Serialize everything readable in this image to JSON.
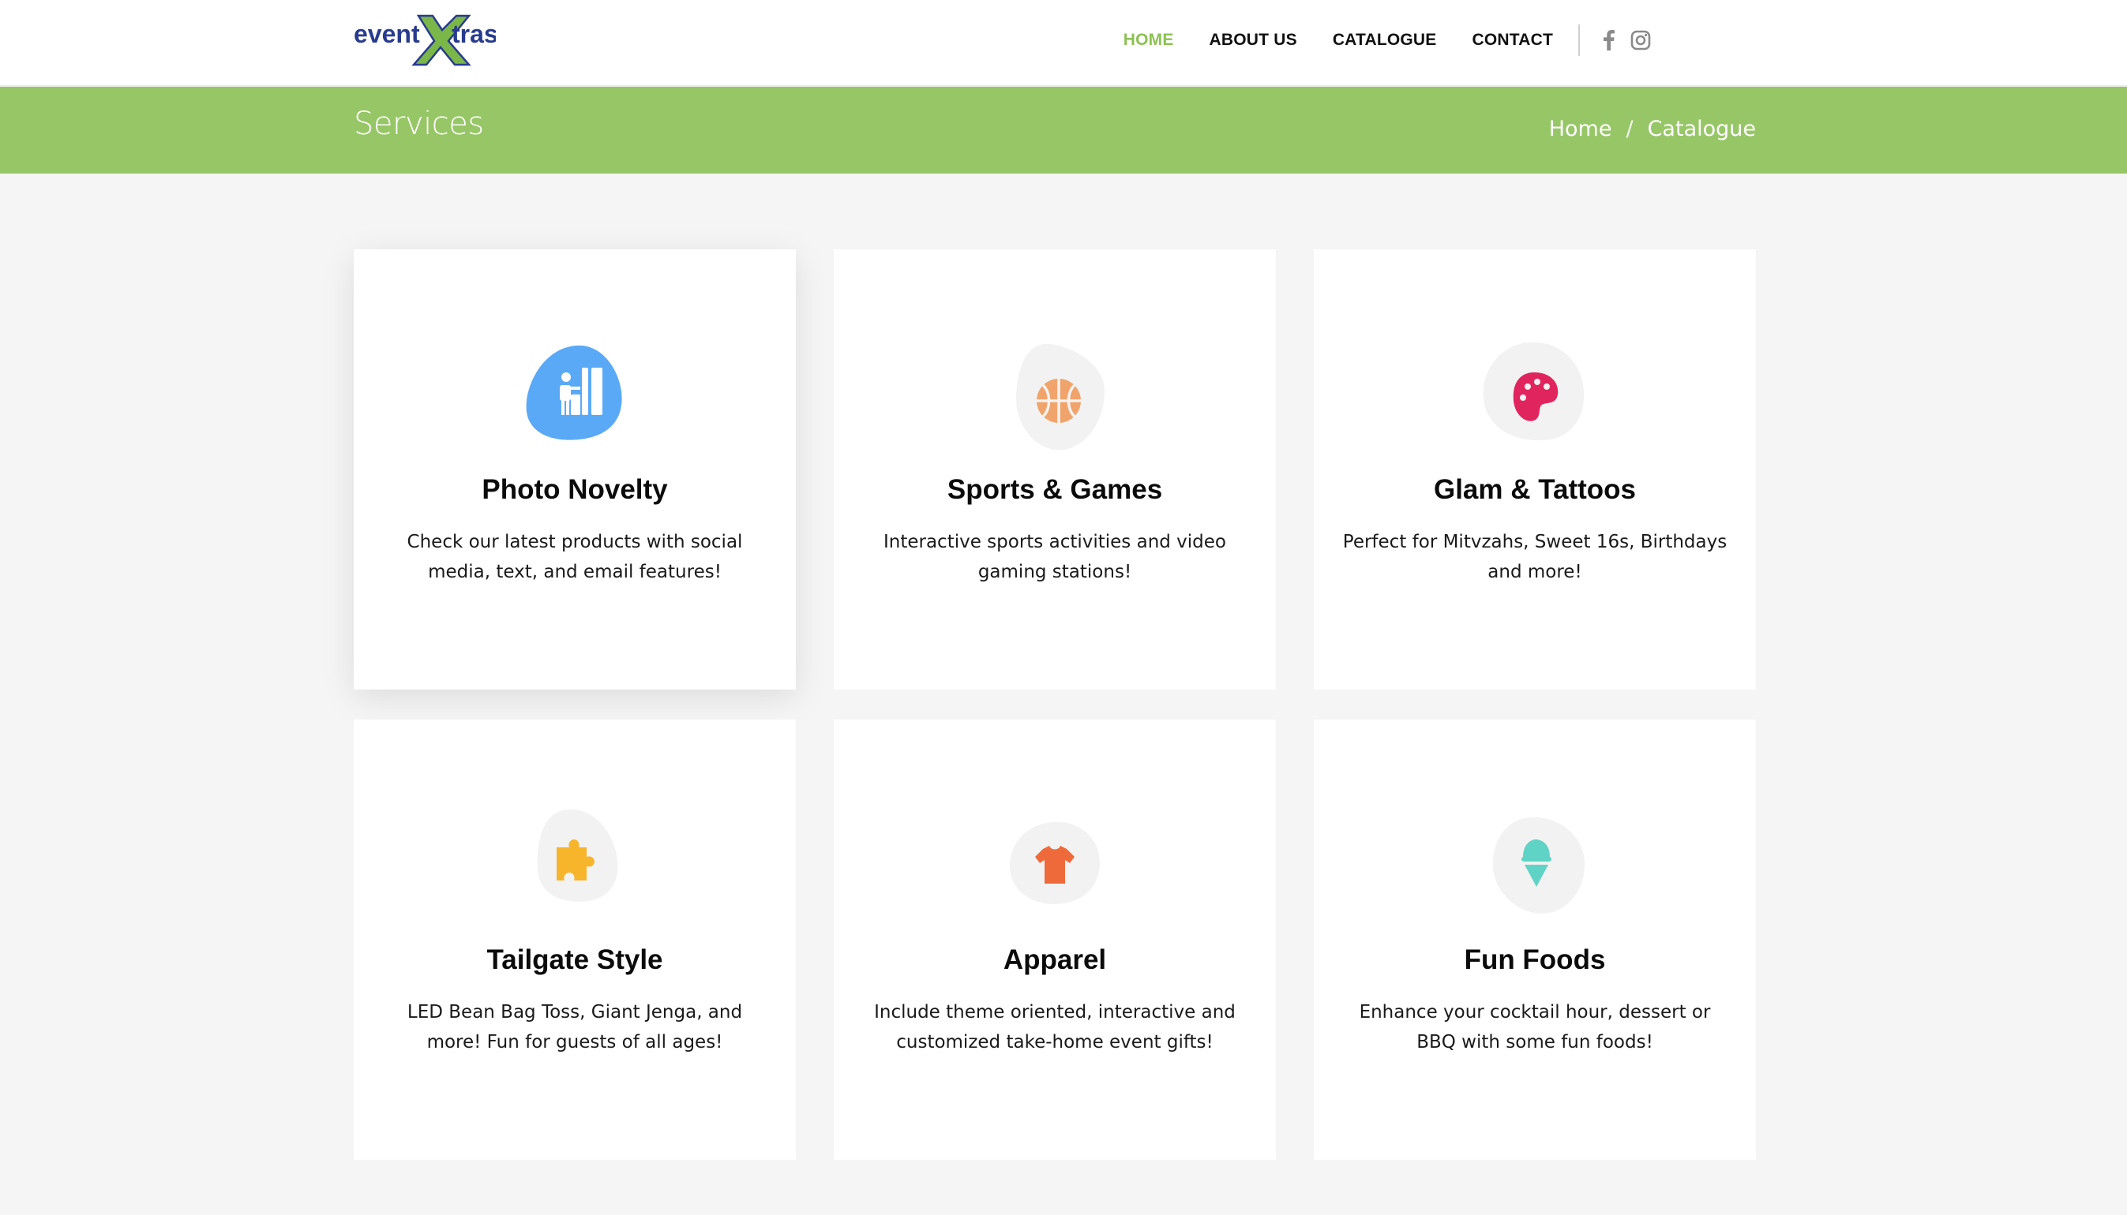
{
  "brand": {
    "logo_left": "event",
    "logo_x": "X",
    "logo_right": "tras"
  },
  "nav": {
    "items": [
      {
        "label": "HOME",
        "active": true
      },
      {
        "label": "ABOUT US",
        "active": false
      },
      {
        "label": "CATALOGUE",
        "active": false
      },
      {
        "label": "CONTACT",
        "active": false
      }
    ],
    "social": [
      "facebook-icon",
      "instagram-icon"
    ]
  },
  "titlebar": {
    "title": "Services",
    "breadcrumb": [
      "Home",
      "Catalogue"
    ],
    "separator": "/"
  },
  "cards": [
    {
      "title": "Photo Novelty",
      "desc": "Check our latest products with social media, text, and email features!",
      "icon": "photo-booth-icon",
      "icon_color": "#ffffff",
      "blob_color": "#5aa9f7"
    },
    {
      "title": "Sports & Games",
      "desc": "Interactive sports activities and video gaming stations!",
      "icon": "basketball-icon",
      "icon_color": "#f0a46b",
      "blob_color": "#f2f2f2"
    },
    {
      "title": "Glam & Tattoos",
      "desc": "Perfect for Mitvzahs, Sweet 16s, Birthdays and more!",
      "icon": "palette-icon",
      "icon_color": "#e0245e",
      "blob_color": "#f2f2f2"
    },
    {
      "title": "Tailgate Style",
      "desc": "LED Bean Bag Toss, Giant Jenga, and more! Fun for guests of all ages!",
      "icon": "puzzle-icon",
      "icon_color": "#f7b52c",
      "blob_color": "#f2f2f2"
    },
    {
      "title": "Apparel",
      "desc": "Include theme oriented, interactive and customized take-home event gifts!",
      "icon": "tshirt-icon",
      "icon_color": "#ef6a3a",
      "blob_color": "#f2f2f2"
    },
    {
      "title": "Fun Foods",
      "desc": "Enhance your cocktail hour, dessert or BBQ with some fun foods!",
      "icon": "ice-cream-icon",
      "icon_color": "#5fd3c5",
      "blob_color": "#f2f2f2"
    }
  ],
  "colors": {
    "accent": "#97c667",
    "nav_active": "#8cc152",
    "logo_blue": "#283b8e",
    "logo_green": "#7ab648"
  }
}
